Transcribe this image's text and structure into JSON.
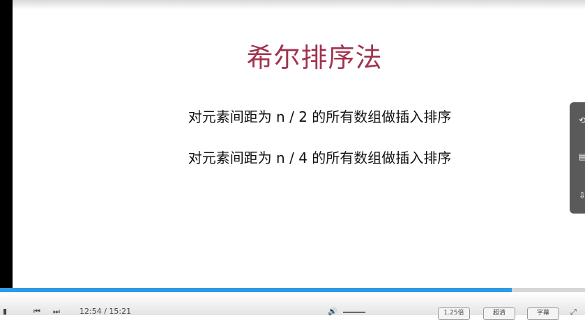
{
  "slide": {
    "title": "希尔排序法",
    "lines": [
      "对元素间距为 n / 2 的所有数组做插入排序",
      "对元素间距为 n / 4 的所有数组做插入排序"
    ]
  },
  "player": {
    "time": "12:54 / 15:21",
    "progress": 0.875,
    "accent_color": "#2e9be6",
    "speed_label": "1.25倍",
    "quality_label": "超清",
    "subtitle_label": "字幕",
    "side_icons": [
      "share-icon",
      "note-icon",
      "download-icon"
    ]
  }
}
